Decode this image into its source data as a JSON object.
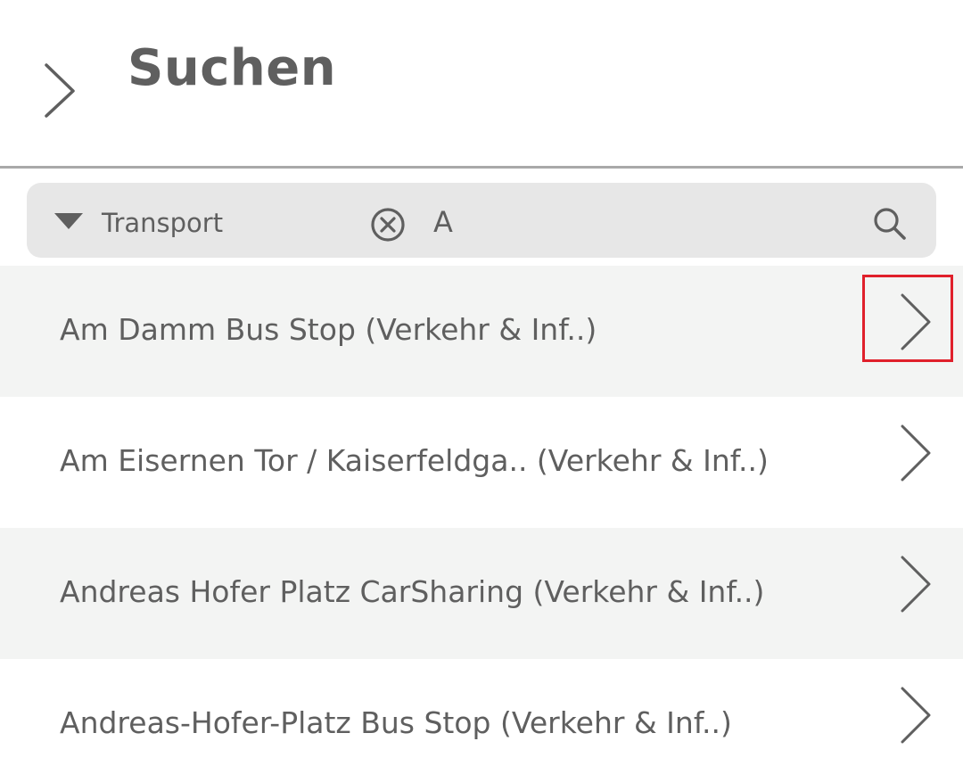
{
  "header": {
    "title": "Suchen",
    "back_icon": "chevron-right-icon"
  },
  "search": {
    "category": "Transport",
    "category_icon": "caret-down-icon",
    "clear_icon": "clear-circle-icon",
    "query": "A",
    "search_icon": "search-icon"
  },
  "results": [
    {
      "label": "Am Damm Bus Stop (Verkehr & Inf..)",
      "highlighted": true
    },
    {
      "label": "Am Eisernen Tor / Kaiserfeldga.. (Verkehr & Inf..)",
      "highlighted": false
    },
    {
      "label": "Andreas Hofer Platz CarSharing (Verkehr & Inf..)",
      "highlighted": false
    },
    {
      "label": "Andreas-Hofer-Platz Bus Stop (Verkehr & Inf..)",
      "highlighted": false
    }
  ],
  "colors": {
    "text": "#5f5f5f",
    "search_bg": "#e7e7e7",
    "row_alt_bg": "#f3f4f3",
    "divider": "#a9a9a9",
    "highlight": "#e0202b"
  }
}
